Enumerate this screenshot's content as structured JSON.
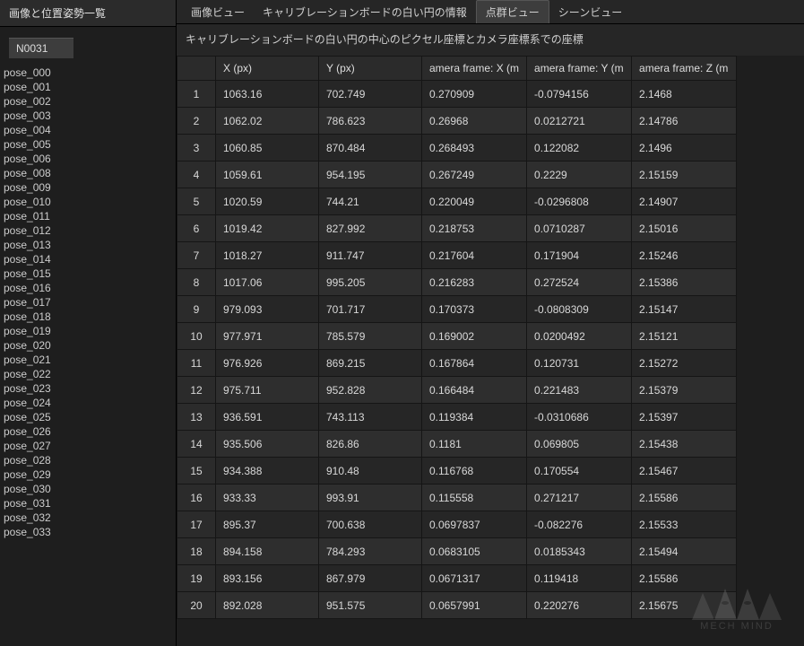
{
  "sidebar": {
    "title": "画像と位置姿勢一覧",
    "current_pose_id": "N0031",
    "items": [
      "pose_000",
      "pose_001",
      "pose_002",
      "pose_003",
      "pose_004",
      "pose_005",
      "pose_006",
      "pose_008",
      "pose_009",
      "pose_010",
      "pose_011",
      "pose_012",
      "pose_013",
      "pose_014",
      "pose_015",
      "pose_016",
      "pose_017",
      "pose_018",
      "pose_019",
      "pose_020",
      "pose_021",
      "pose_022",
      "pose_023",
      "pose_024",
      "pose_025",
      "pose_026",
      "pose_027",
      "pose_028",
      "pose_029",
      "pose_030",
      "pose_031",
      "pose_032",
      "pose_033"
    ]
  },
  "tabs": {
    "items": [
      "画像ビュー",
      "キャリブレーションボードの白い円の情報",
      "点群ビュー",
      "シーンビュー"
    ],
    "active_index": 2
  },
  "description": "キャリブレーションボードの白い円の中心のピクセル座標とカメラ座標系での座標",
  "table": {
    "headers": [
      "X (px)",
      "Y (px)",
      "amera frame: X (m",
      "amera frame: Y (m",
      "amera frame: Z (m"
    ],
    "rows": [
      {
        "i": "1",
        "x": "1063.16",
        "y": "702.749",
        "cx": "0.270909",
        "cy": "-0.0794156",
        "cz": "2.1468"
      },
      {
        "i": "2",
        "x": "1062.02",
        "y": "786.623",
        "cx": "0.26968",
        "cy": "0.0212721",
        "cz": "2.14786"
      },
      {
        "i": "3",
        "x": "1060.85",
        "y": "870.484",
        "cx": "0.268493",
        "cy": "0.122082",
        "cz": "2.1496"
      },
      {
        "i": "4",
        "x": "1059.61",
        "y": "954.195",
        "cx": "0.267249",
        "cy": "0.2229",
        "cz": "2.15159"
      },
      {
        "i": "5",
        "x": "1020.59",
        "y": "744.21",
        "cx": "0.220049",
        "cy": "-0.0296808",
        "cz": "2.14907"
      },
      {
        "i": "6",
        "x": "1019.42",
        "y": "827.992",
        "cx": "0.218753",
        "cy": "0.0710287",
        "cz": "2.15016"
      },
      {
        "i": "7",
        "x": "1018.27",
        "y": "911.747",
        "cx": "0.217604",
        "cy": "0.171904",
        "cz": "2.15246"
      },
      {
        "i": "8",
        "x": "1017.06",
        "y": "995.205",
        "cx": "0.216283",
        "cy": "0.272524",
        "cz": "2.15386"
      },
      {
        "i": "9",
        "x": "979.093",
        "y": "701.717",
        "cx": "0.170373",
        "cy": "-0.0808309",
        "cz": "2.15147"
      },
      {
        "i": "10",
        "x": "977.971",
        "y": "785.579",
        "cx": "0.169002",
        "cy": "0.0200492",
        "cz": "2.15121"
      },
      {
        "i": "11",
        "x": "976.926",
        "y": "869.215",
        "cx": "0.167864",
        "cy": "0.120731",
        "cz": "2.15272"
      },
      {
        "i": "12",
        "x": "975.711",
        "y": "952.828",
        "cx": "0.166484",
        "cy": "0.221483",
        "cz": "2.15379"
      },
      {
        "i": "13",
        "x": "936.591",
        "y": "743.113",
        "cx": "0.119384",
        "cy": "-0.0310686",
        "cz": "2.15397"
      },
      {
        "i": "14",
        "x": "935.506",
        "y": "826.86",
        "cx": "0.1181",
        "cy": "0.069805",
        "cz": "2.15438"
      },
      {
        "i": "15",
        "x": "934.388",
        "y": "910.48",
        "cx": "0.116768",
        "cy": "0.170554",
        "cz": "2.15467"
      },
      {
        "i": "16",
        "x": "933.33",
        "y": "993.91",
        "cx": "0.115558",
        "cy": "0.271217",
        "cz": "2.15586"
      },
      {
        "i": "17",
        "x": "895.37",
        "y": "700.638",
        "cx": "0.0697837",
        "cy": "-0.082276",
        "cz": "2.15533"
      },
      {
        "i": "18",
        "x": "894.158",
        "y": "784.293",
        "cx": "0.0683105",
        "cy": "0.0185343",
        "cz": "2.15494"
      },
      {
        "i": "19",
        "x": "893.156",
        "y": "867.979",
        "cx": "0.0671317",
        "cy": "0.119418",
        "cz": "2.15586"
      },
      {
        "i": "20",
        "x": "892.028",
        "y": "951.575",
        "cx": "0.0657991",
        "cy": "0.220276",
        "cz": "2.15675"
      }
    ]
  },
  "watermark": {
    "text": "MECH MIND"
  }
}
